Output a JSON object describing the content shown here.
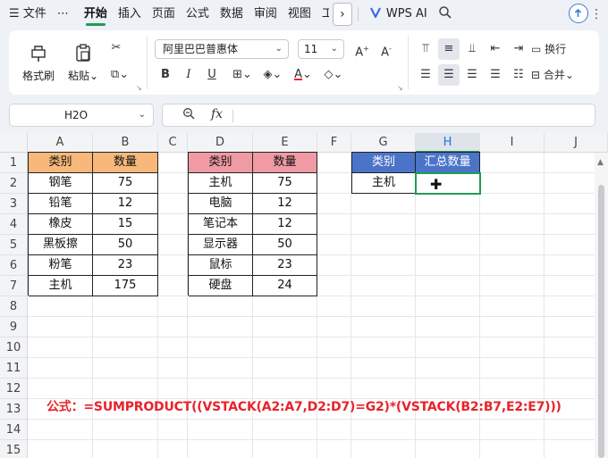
{
  "menu": {
    "file": "文件",
    "more": "⋯",
    "tabs": [
      "开始",
      "插入",
      "页面",
      "公式",
      "数据",
      "审阅",
      "视图",
      "工"
    ],
    "active_tab": "开始",
    "ai": "WPS AI"
  },
  "ribbon": {
    "format_painter": "格式刷",
    "paste": "粘贴",
    "font_name": "阿里巴巴普惠体",
    "font_size": "11",
    "wrap": "换行",
    "merge": "合并",
    "bold": "B",
    "italic": "I",
    "underline": "U"
  },
  "formula_bar": {
    "cell_ref": "H2O",
    "fx": "fx",
    "formula": ""
  },
  "sheet": {
    "columns": [
      "A",
      "B",
      "C",
      "D",
      "E",
      "F",
      "G",
      "H",
      "I",
      "J"
    ],
    "selected_column": "H",
    "rows": [
      "1",
      "2",
      "3",
      "4",
      "5",
      "6",
      "7",
      "8",
      "9",
      "10",
      "11",
      "12",
      "13",
      "14",
      "15"
    ],
    "table1": {
      "header": [
        "类别",
        "数量"
      ],
      "rows": [
        [
          "钢笔",
          "75"
        ],
        [
          "铅笔",
          "12"
        ],
        [
          "橡皮",
          "15"
        ],
        [
          "黑板擦",
          "50"
        ],
        [
          "粉笔",
          "23"
        ],
        [
          "主机",
          "175"
        ]
      ]
    },
    "table2": {
      "header": [
        "类别",
        "数量"
      ],
      "rows": [
        [
          "主机",
          "75"
        ],
        [
          "电脑",
          "12"
        ],
        [
          "笔记本",
          "12"
        ],
        [
          "显示器",
          "50"
        ],
        [
          "鼠标",
          "23"
        ],
        [
          "硬盘",
          "24"
        ]
      ]
    },
    "table3": {
      "header": [
        "类别",
        "汇总数量"
      ],
      "rows": [
        [
          "主机",
          ""
        ]
      ]
    },
    "note": "公式：=SUMPRODUCT((VSTACK(A2:A7,D2:D7)=G2)*(VSTACK(B2:B7,E2:E7)))"
  },
  "colors": {
    "accent_green": "#1f9d55",
    "header_orange": "#f7b87a",
    "header_pink": "#f09aa3",
    "header_blue": "#4b74c9",
    "note_red": "#e8232a"
  }
}
